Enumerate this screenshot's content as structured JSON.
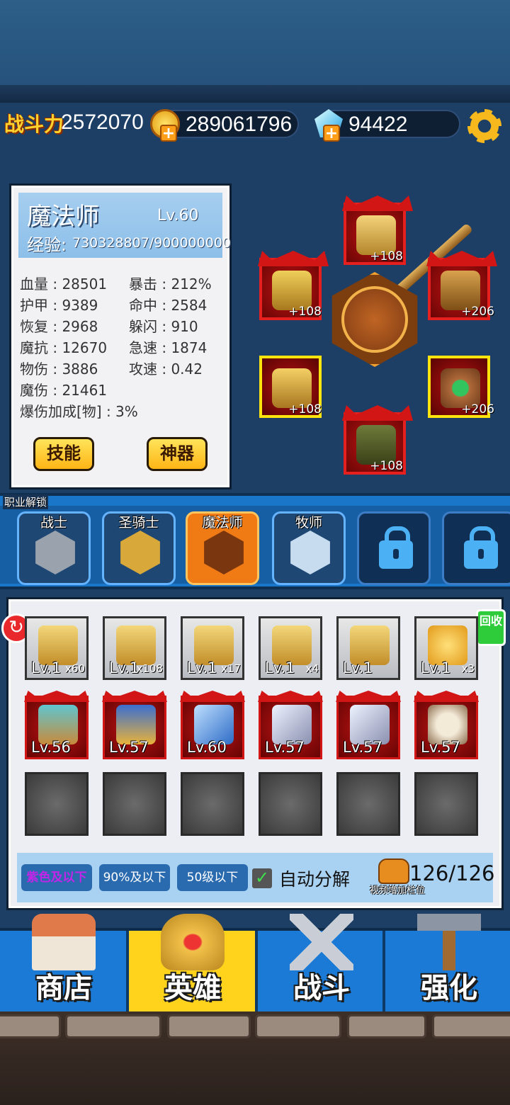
{
  "stats_bar": {
    "power_label": "战斗力",
    "power_value": "2572070",
    "gold_value": "289061796",
    "gem_value": "94422",
    "icons": [
      "gold-coin-icon",
      "plus-icon",
      "gem-icon",
      "gear-icon"
    ]
  },
  "hero": {
    "name": "魔法师",
    "level": "Lv.60",
    "exp_label": "经验:",
    "exp_value": "730328807/900000000",
    "stats_left": [
      "血量 : 28501",
      "护甲 : 9389",
      "恢复 : 2968",
      "魔抗 : 12670",
      "物伤 : 3886",
      "魔伤 : 21461",
      "爆伤加成[物] : 3%"
    ],
    "stats_right": [
      "暴击 : 212%",
      "命中 : 2584",
      "躲闪 : 910",
      "急速 : 1874",
      "攻速 : 0.42"
    ],
    "skill_button": "技能",
    "artifact_button": "神器"
  },
  "equipment": {
    "helmet": "+108",
    "armor": "+108",
    "accessory_top": "+206",
    "amulet": "+108",
    "ring": "+206",
    "boots": "+108"
  },
  "classes": {
    "unlock_label": "职业解锁",
    "tabs": [
      "战士",
      "圣骑士",
      "魔法师",
      "牧师"
    ],
    "active_index": 2
  },
  "inventory": {
    "recycle_label": "回收",
    "row1": [
      {
        "lv": "Lv.1",
        "qty": "x60"
      },
      {
        "lv": "Lv.1",
        "qty": "x108"
      },
      {
        "lv": "Lv.1",
        "qty": "x17"
      },
      {
        "lv": "Lv.1",
        "qty": "x4"
      },
      {
        "lv": "Lv.1",
        "qty": ""
      },
      {
        "lv": "Lv.1",
        "qty": "x3"
      }
    ],
    "row2": [
      "Lv.56",
      "Lv.57",
      "Lv.60",
      "Lv.57",
      "Lv.57",
      "Lv.57"
    ],
    "filters": [
      "紫色及以下",
      "90%及以下",
      "50级以下"
    ],
    "auto_label": "自动分解",
    "capacity": "126/126",
    "video_label": "视频增加栏位",
    "colors": {
      "purple_filter": "#c424e8",
      "check": "#3fe04a"
    }
  },
  "nav": {
    "items": [
      "商店",
      "英雄",
      "战斗",
      "强化"
    ],
    "active_index": 1
  }
}
